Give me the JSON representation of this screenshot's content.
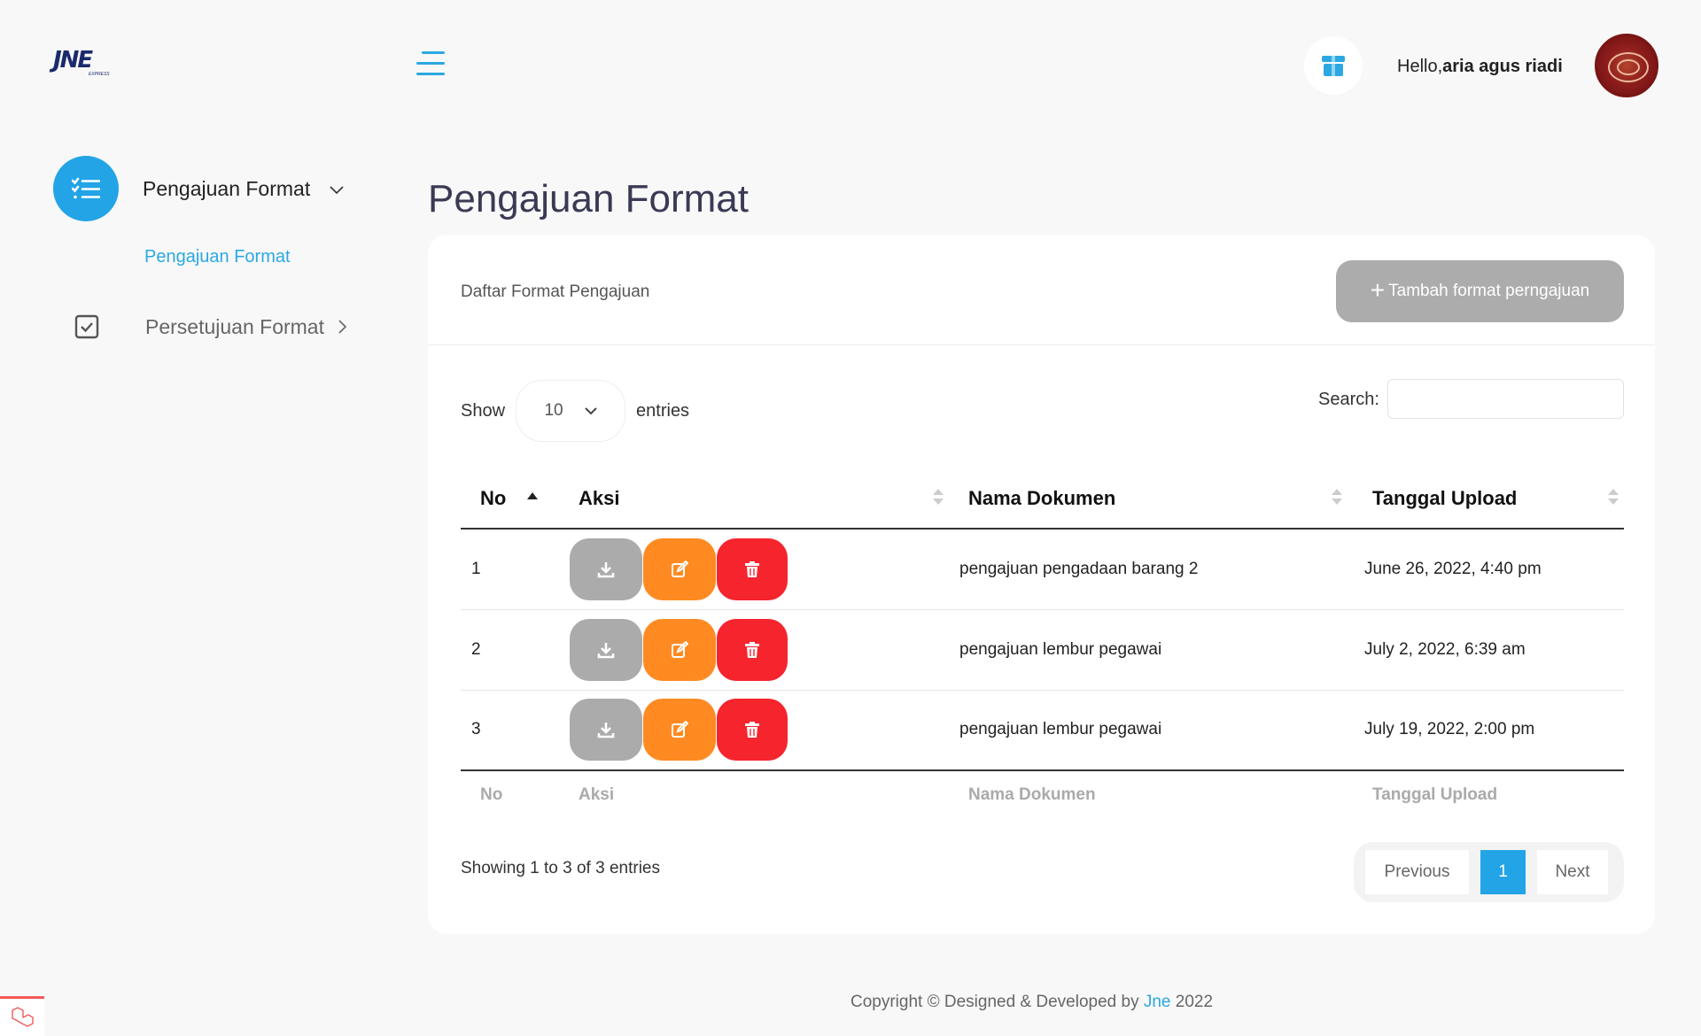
{
  "header": {
    "logo_text": "JNE",
    "logo_sub": "EXPRESS",
    "greeting": "Hello,",
    "user_name": "aria agus riadi"
  },
  "sidebar": {
    "items": [
      {
        "label": "Pengajuan Format",
        "icon": "list-check-icon",
        "expanded": true,
        "children": [
          {
            "label": "Pengajuan Format"
          }
        ]
      },
      {
        "label": "Persetujuan Format",
        "icon": "check-square-icon",
        "expanded": false
      }
    ]
  },
  "page": {
    "title": "Pengajuan Format"
  },
  "card": {
    "title": "Daftar Format Pengajuan",
    "add_button": "Tambah format perngajuan",
    "show_label": "Show",
    "page_size": "10",
    "entries_label": "entries",
    "search_label": "Search:",
    "search_value": ""
  },
  "table": {
    "columns": [
      "No",
      "Aksi",
      "Nama Dokumen",
      "Tanggal Upload"
    ],
    "rows": [
      {
        "no": "1",
        "nama": "pengajuan pengadaan barang 2",
        "tanggal": "June 26, 2022, 4:40 pm"
      },
      {
        "no": "2",
        "nama": "pengajuan lembur pegawai",
        "tanggal": "July 2, 2022, 6:39 am"
      },
      {
        "no": "3",
        "nama": "pengajuan lembur pegawai",
        "tanggal": "July 19, 2022, 2:00 pm"
      }
    ],
    "info": "Showing 1 to 3 of 3 entries"
  },
  "pagination": {
    "previous": "Previous",
    "current": "1",
    "next": "Next"
  },
  "footer": {
    "prefix": "Copyright © Designed & Developed by ",
    "link": "Jne",
    "suffix": " 2022"
  },
  "colors": {
    "accent": "#23a4e6",
    "download": "#ababab",
    "edit": "#ff8a21",
    "delete": "#f5242d"
  }
}
